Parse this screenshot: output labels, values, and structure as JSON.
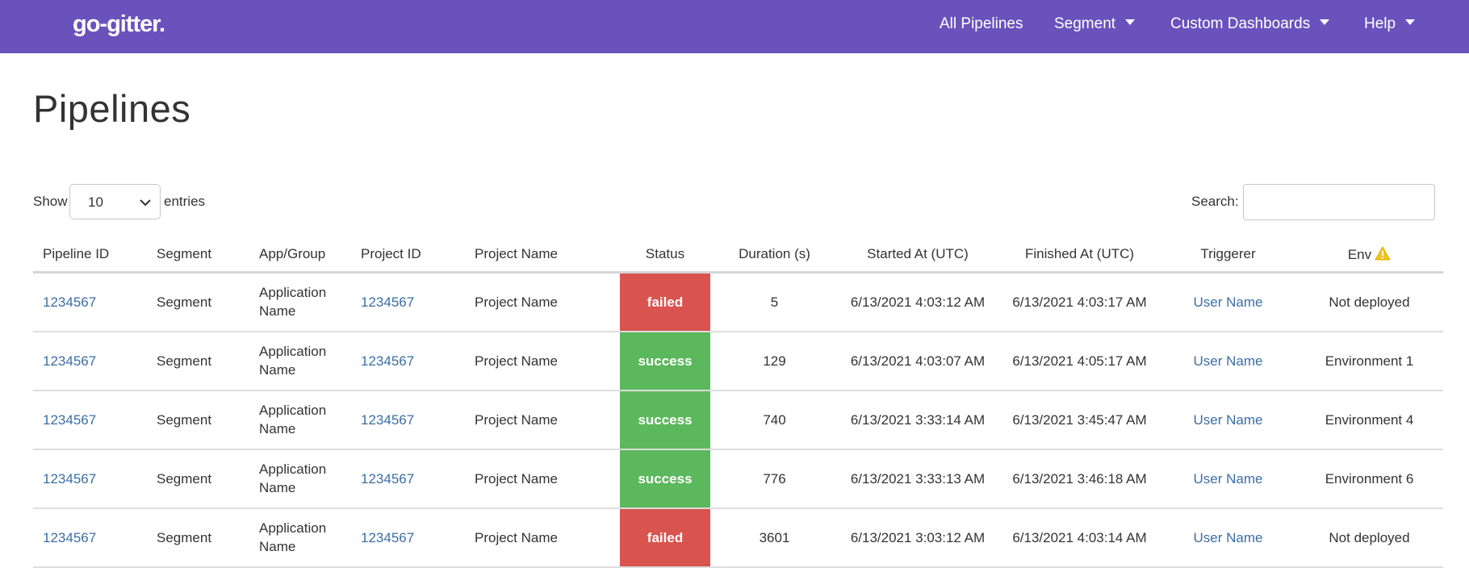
{
  "navbar": {
    "brand": "go-gitter.",
    "items": [
      {
        "label": "All Pipelines",
        "dropdown": false
      },
      {
        "label": "Segment",
        "dropdown": true
      },
      {
        "label": "Custom Dashboards",
        "dropdown": true
      },
      {
        "label": "Help",
        "dropdown": true
      }
    ],
    "background_color": "#6a52bd"
  },
  "page": {
    "title": "Pipelines"
  },
  "controls": {
    "show_label": "Show",
    "entries_value": "10",
    "entries_label": "entries",
    "search_label": "Search:",
    "search_value": ""
  },
  "table": {
    "columns": [
      "Pipeline ID",
      "Segment",
      "App/Group",
      "Project ID",
      "Project Name",
      "Status",
      "Duration (s)",
      "Started At (UTC)",
      "Finished At (UTC)",
      "Triggerer",
      "Env"
    ],
    "env_header_icon": "warning-icon",
    "rows": [
      {
        "pipeline_id": "1234567",
        "segment": "Segment",
        "app_group": "Application Name",
        "project_id": "1234567",
        "project_name": "Project Name",
        "status": "failed",
        "duration": "5",
        "started_at": "6/13/2021 4:03:12 AM",
        "finished_at": "6/13/2021 4:03:17 AM",
        "triggerer": "User Name",
        "env": "Not deployed"
      },
      {
        "pipeline_id": "1234567",
        "segment": "Segment",
        "app_group": "Application Name",
        "project_id": "1234567",
        "project_name": "Project Name",
        "status": "success",
        "duration": "129",
        "started_at": "6/13/2021 4:03:07 AM",
        "finished_at": "6/13/2021 4:05:17 AM",
        "triggerer": "User Name",
        "env": "Environment 1"
      },
      {
        "pipeline_id": "1234567",
        "segment": "Segment",
        "app_group": "Application Name",
        "project_id": "1234567",
        "project_name": "Project Name",
        "status": "success",
        "duration": "740",
        "started_at": "6/13/2021 3:33:14 AM",
        "finished_at": "6/13/2021 3:45:47 AM",
        "triggerer": "User Name",
        "env": "Environment 4"
      },
      {
        "pipeline_id": "1234567",
        "segment": "Segment",
        "app_group": "Application Name",
        "project_id": "1234567",
        "project_name": "Project Name",
        "status": "success",
        "duration": "776",
        "started_at": "6/13/2021 3:33:13 AM",
        "finished_at": "6/13/2021 3:46:18 AM",
        "triggerer": "User Name",
        "env": "Environment 6"
      },
      {
        "pipeline_id": "1234567",
        "segment": "Segment",
        "app_group": "Application Name",
        "project_id": "1234567",
        "project_name": "Project Name",
        "status": "failed",
        "duration": "3601",
        "started_at": "6/13/2021 3:03:12 AM",
        "finished_at": "6/13/2021 4:03:14 AM",
        "triggerer": "User Name",
        "env": "Not deployed"
      }
    ]
  },
  "colors": {
    "link": "#3a6ea5",
    "status_failed": "#d9534f",
    "status_success": "#5cb85c",
    "warning": "#f0c419"
  }
}
